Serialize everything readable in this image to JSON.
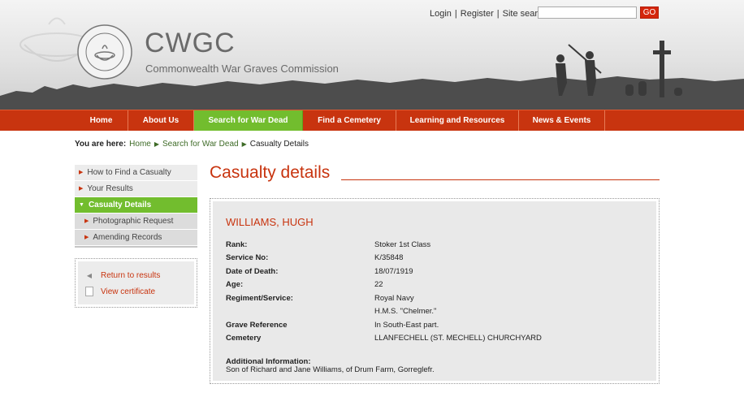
{
  "header": {
    "brand_short": "CWGC",
    "brand_long": "Commonwealth War Graves Commission",
    "seal_text": "COMMONWEALTH WAR GRAVES COMMISSION",
    "login": "Login",
    "register": "Register",
    "separator": "|",
    "search_label": "Site search:",
    "search_value": "",
    "go_label": "GO"
  },
  "nav": {
    "items": [
      "Home",
      "About Us",
      "Search for War Dead",
      "Find a Cemetery",
      "Learning and Resources",
      "News & Events"
    ],
    "active_index": 2
  },
  "breadcrumb": {
    "lead": "You are here:",
    "items": [
      "Home",
      "Search for War Dead",
      "Casualty Details"
    ]
  },
  "sidebar": {
    "items": [
      "How to Find a Casualty",
      "Your Results",
      "Casualty Details",
      "Photographic Request",
      "Amending Records"
    ],
    "active_index": 2
  },
  "actions": {
    "return": "Return to results",
    "certificate": "View certificate"
  },
  "page": {
    "title": "Casualty details"
  },
  "casualty": {
    "name": "WILLIAMS, HUGH",
    "rank_label": "Rank:",
    "rank": "Stoker 1st Class",
    "service_label": "Service No:",
    "service": "K/35848",
    "death_label": "Date of Death:",
    "death": "18/07/1919",
    "age_label": "Age:",
    "age": "22",
    "regiment_label": "Regiment/Service:",
    "regiment": "Royal Navy",
    "regiment_unit": "H.M.S. \"Chelmer.\"",
    "grave_label": "Grave Reference",
    "grave": "In South-East part.",
    "cemetery_label": "Cemetery",
    "cemetery": "LLANFECHELL (ST. MECHELL) CHURCHYARD",
    "additional_label": "Additional Information:",
    "additional": "Son of Richard and Jane Williams, of Drum Farm, Gorreglefr."
  },
  "colors": {
    "accent_red": "#c8340f",
    "active_green": "#72bd2e",
    "link_green": "#3e6b27"
  }
}
